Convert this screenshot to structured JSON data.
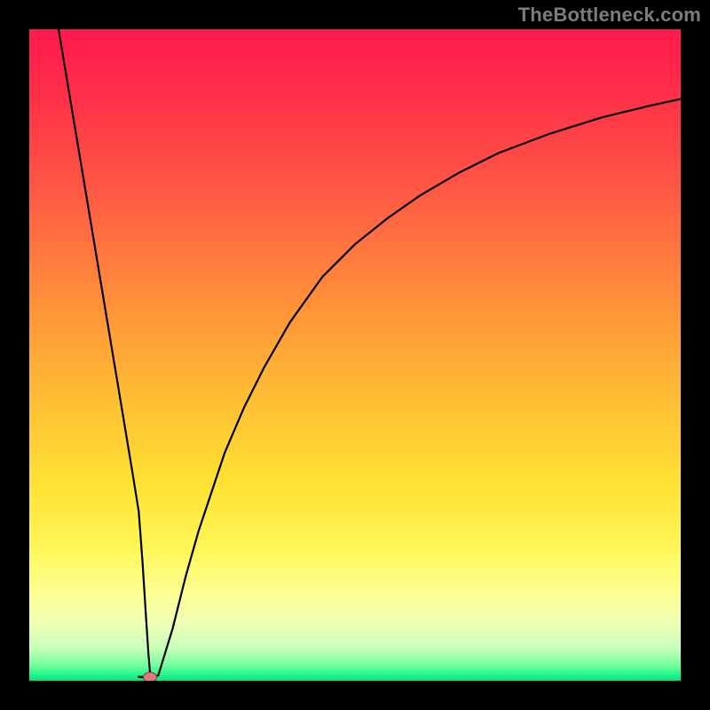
{
  "watermark": "TheBottleneck.com",
  "chart_data": {
    "type": "line",
    "title": "",
    "xlabel": "",
    "ylabel": "",
    "xlim": [
      0,
      100
    ],
    "ylim": [
      0,
      100
    ],
    "grid": false,
    "legend": false,
    "marker": {
      "x": 18.5,
      "y": 0.5,
      "color": "#e07a7c"
    },
    "series": [
      {
        "name": "left-branch",
        "x": [
          4.5,
          6,
          8,
          10,
          12,
          14,
          15,
          16,
          16.8
        ],
        "y": [
          100,
          91,
          79,
          67,
          55,
          43,
          37,
          31,
          26
        ]
      },
      {
        "name": "left-branch-lower",
        "x": [
          16.8,
          17.4,
          17.9,
          18.3,
          18.6
        ],
        "y": [
          26,
          18,
          10,
          4,
          0.5
        ]
      },
      {
        "name": "flat-bottom",
        "x": [
          16.8,
          17.5,
          18.2,
          19,
          19.8
        ],
        "y": [
          0.6,
          0.5,
          0.5,
          0.6,
          0.8
        ]
      },
      {
        "name": "right-branch",
        "x": [
          19.8,
          22,
          24,
          26,
          28,
          30,
          33,
          36,
          40,
          45,
          50,
          55,
          60,
          66,
          72,
          80,
          88,
          95,
          100
        ],
        "y": [
          0.8,
          8,
          16,
          23,
          29,
          35,
          42,
          48,
          55,
          62,
          67,
          71,
          74.5,
          78,
          81,
          84,
          86.5,
          88.2,
          89.3
        ]
      }
    ],
    "background_gradient": {
      "stops": [
        {
          "pos": 0.0,
          "color": "#ff1a4d"
        },
        {
          "pos": 0.25,
          "color": "#ff5944"
        },
        {
          "pos": 0.55,
          "color": "#ffb935"
        },
        {
          "pos": 0.8,
          "color": "#fff75a"
        },
        {
          "pos": 0.95,
          "color": "#c7ffba"
        },
        {
          "pos": 1.0,
          "color": "#05e07d"
        }
      ]
    }
  }
}
